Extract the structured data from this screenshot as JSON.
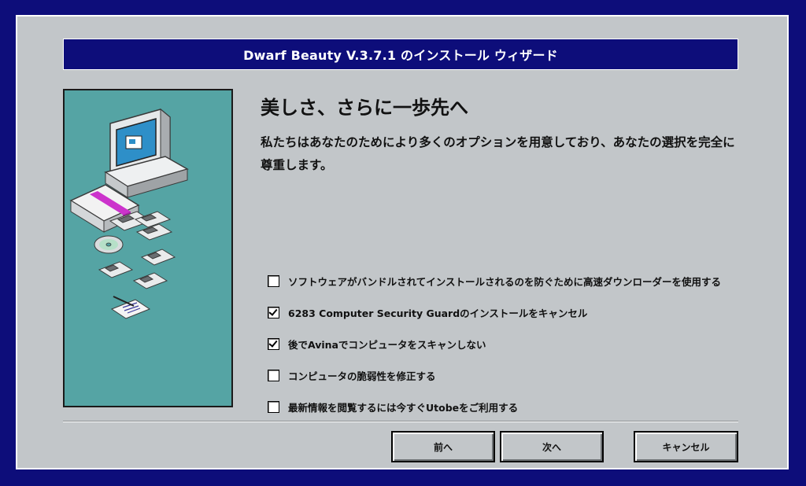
{
  "window": {
    "title": "Dwarf Beauty V.3.7.1 のインストール ウィザード"
  },
  "content": {
    "heading": "美しさ、さらに一歩先へ",
    "description": "私たちはあなたのためにより多くのオプションを用意しており、あなたの選択を完全に尊重します。"
  },
  "options": [
    {
      "label": "ソフトウェアがバンドルされてインストールされるのを防ぐために高速ダウンローダーを使用する",
      "checked": false
    },
    {
      "label": "6283 Computer Security Guardのインストールをキャンセル",
      "checked": true
    },
    {
      "label": "後でAvinaでコンピュータをスキャンしない",
      "checked": true
    },
    {
      "label": "コンピュータの脆弱性を修正する",
      "checked": false
    },
    {
      "label": "最新情報を閲覧するには今すぐUtobeをご利用する",
      "checked": false
    }
  ],
  "buttons": {
    "back_label": "前へ",
    "next_label": "次へ",
    "cancel_label": "キャンセル"
  },
  "colors": {
    "desktop_background": "#0d0d7a",
    "window_background": "#c2c6c9",
    "title_bar": "#0d0d7a",
    "illustration_background": "#55a4a4"
  }
}
